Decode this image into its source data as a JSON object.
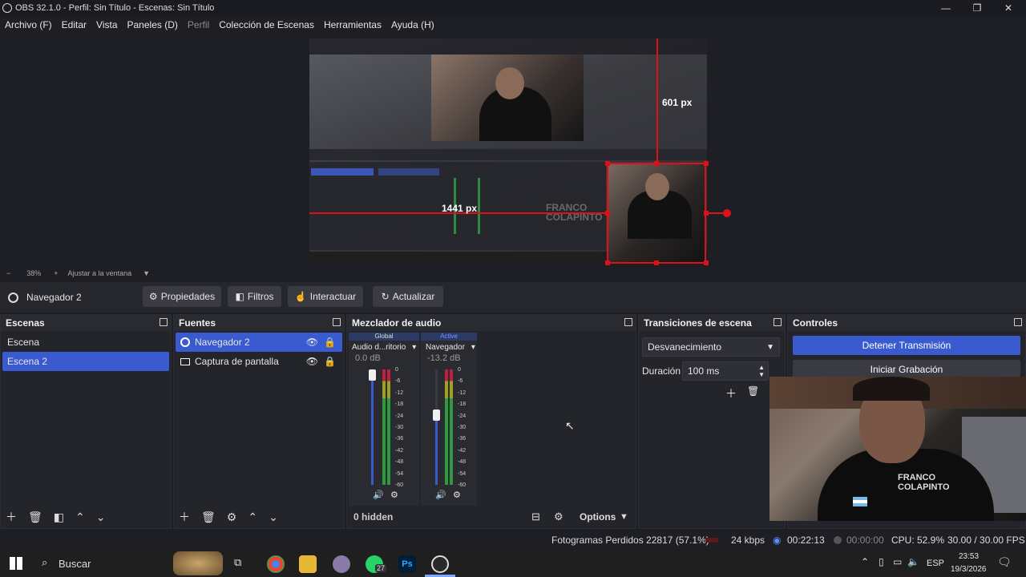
{
  "window": {
    "title": "OBS 32.1.0 - Perfil: Sin Título - Escenas: Sin Título",
    "minimize": "—",
    "maximize": "❐",
    "close": "✕"
  },
  "menu": [
    {
      "label": "Archivo (F)",
      "enabled": true
    },
    {
      "label": "Editar",
      "enabled": true
    },
    {
      "label": "Vista",
      "enabled": true
    },
    {
      "label": "Paneles (D)",
      "enabled": true
    },
    {
      "label": "Perfil",
      "enabled": false
    },
    {
      "label": "Colección de Escenas",
      "enabled": true
    },
    {
      "label": "Herramientas",
      "enabled": true
    },
    {
      "label": "Ayuda (H)",
      "enabled": true
    }
  ],
  "preview": {
    "height_label": "601 px",
    "width_label": "1441 px",
    "shirt_text_1": "FRANCO",
    "shirt_text_2": "COLAPINTO"
  },
  "zoom": {
    "minus": "−",
    "level": "38%",
    "plus": "+",
    "fit": "Ajustar a la ventana"
  },
  "source_toolbar": {
    "selected_source": "Navegador 2",
    "properties": "Propiedades",
    "filters": "Filtros",
    "interact": "Interactuar",
    "refresh": "Actualizar"
  },
  "scenes": {
    "title": "Escenas",
    "items": [
      "Escena",
      "Escena 2"
    ],
    "selected": 1
  },
  "sources": {
    "title": "Fuentes",
    "items": [
      {
        "label": "Navegador 2",
        "icon": "globe-icon",
        "selected": true
      },
      {
        "label": "Captura de pantalla",
        "icon": "monitor-icon",
        "selected": false
      }
    ]
  },
  "mixer": {
    "title": "Mezclador de audio",
    "hidden_label": "0 hidden",
    "options_label": "Options",
    "channels": [
      {
        "tag": "Global",
        "name": "Audio d...ritorio",
        "db": "0.0 dB",
        "level": 1.0
      },
      {
        "tag": "Active",
        "name": "Navegador",
        "db": "-13.2 dB",
        "level": 0.6
      }
    ],
    "scale": [
      "0",
      "-6",
      "-12",
      "-18",
      "-24",
      "-30",
      "-36",
      "-42",
      "-48",
      "-54",
      "-60"
    ]
  },
  "transitions": {
    "title": "Transiciones de escena",
    "transition": "Desvanecimiento",
    "duration_label": "Duración",
    "duration_value": "100 ms"
  },
  "controls": {
    "title": "Controles",
    "stop_stream": "Detener Transmisión",
    "start_record": "Iniciar Grabación"
  },
  "status": {
    "dropped": "Fotogramas Perdidos 22817 (57.1%)",
    "bitrate": "24 kbps",
    "stream_time": "00:22:13",
    "rec_time": "00:00:00",
    "cpu": "CPU: 52.9%",
    "fps": "30.00 / 30.00 FPS"
  },
  "taskbar": {
    "search": "Buscar",
    "lang": "ESP",
    "time": "23:53",
    "date": "19/3/2026",
    "badge": "27",
    "ps": "Ps"
  },
  "colors": {
    "accent": "#3a5bd0",
    "red_guide": "#e0101a",
    "meter_green": "#2e9a3e"
  }
}
